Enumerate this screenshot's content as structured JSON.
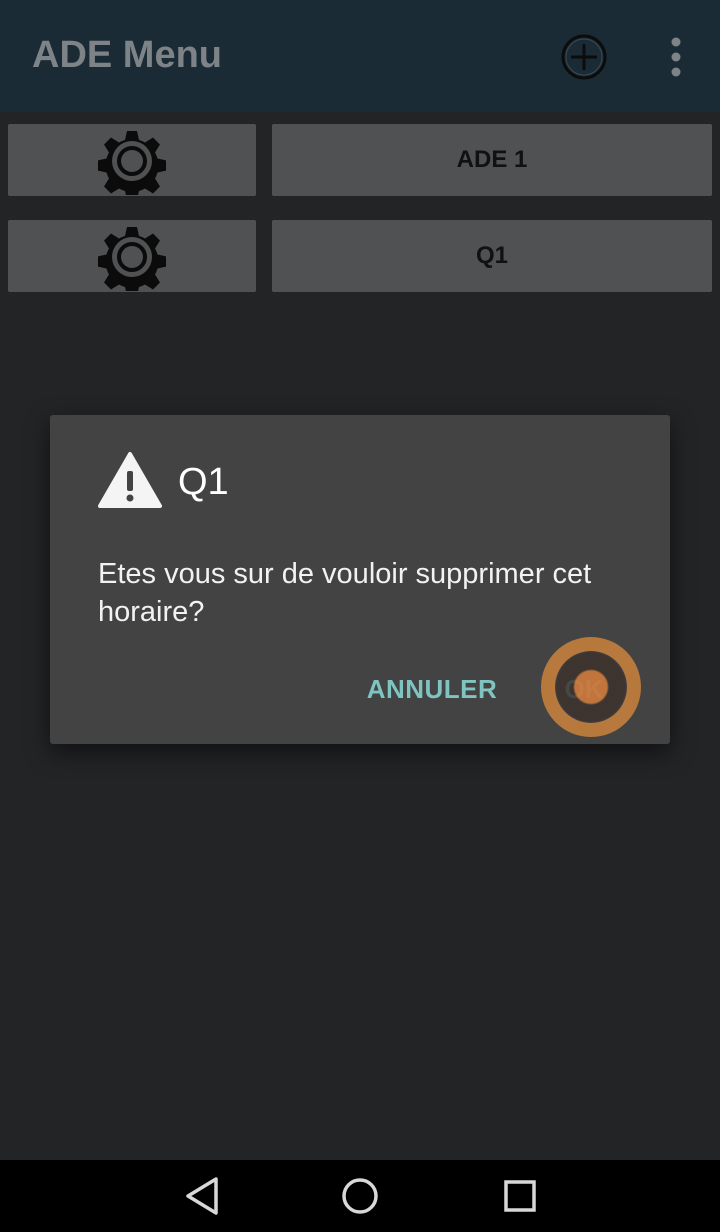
{
  "appbar": {
    "title": "ADE Menu",
    "add_icon": "add-circle-icon",
    "more_icon": "more-vert-icon"
  },
  "list": {
    "items": [
      {
        "label": "ADE 1",
        "icon": "gear-icon"
      },
      {
        "label": "Q1",
        "icon": "gear-icon"
      }
    ]
  },
  "dialog": {
    "icon": "warning-icon",
    "title": "Q1",
    "message": "Etes vous sur de vouloir supprimer cet horaire?",
    "cancel_label": "ANNULER",
    "ok_label": "OK"
  },
  "navbar": {
    "back_icon": "back-triangle-icon",
    "home_icon": "home-circle-icon",
    "recent_icon": "recent-square-icon"
  },
  "colors": {
    "background": "#232426",
    "appbar": "#1b2b36",
    "dialog": "#434343",
    "accent": "#7fc4c0",
    "touch_indicator": "#c4803e"
  }
}
